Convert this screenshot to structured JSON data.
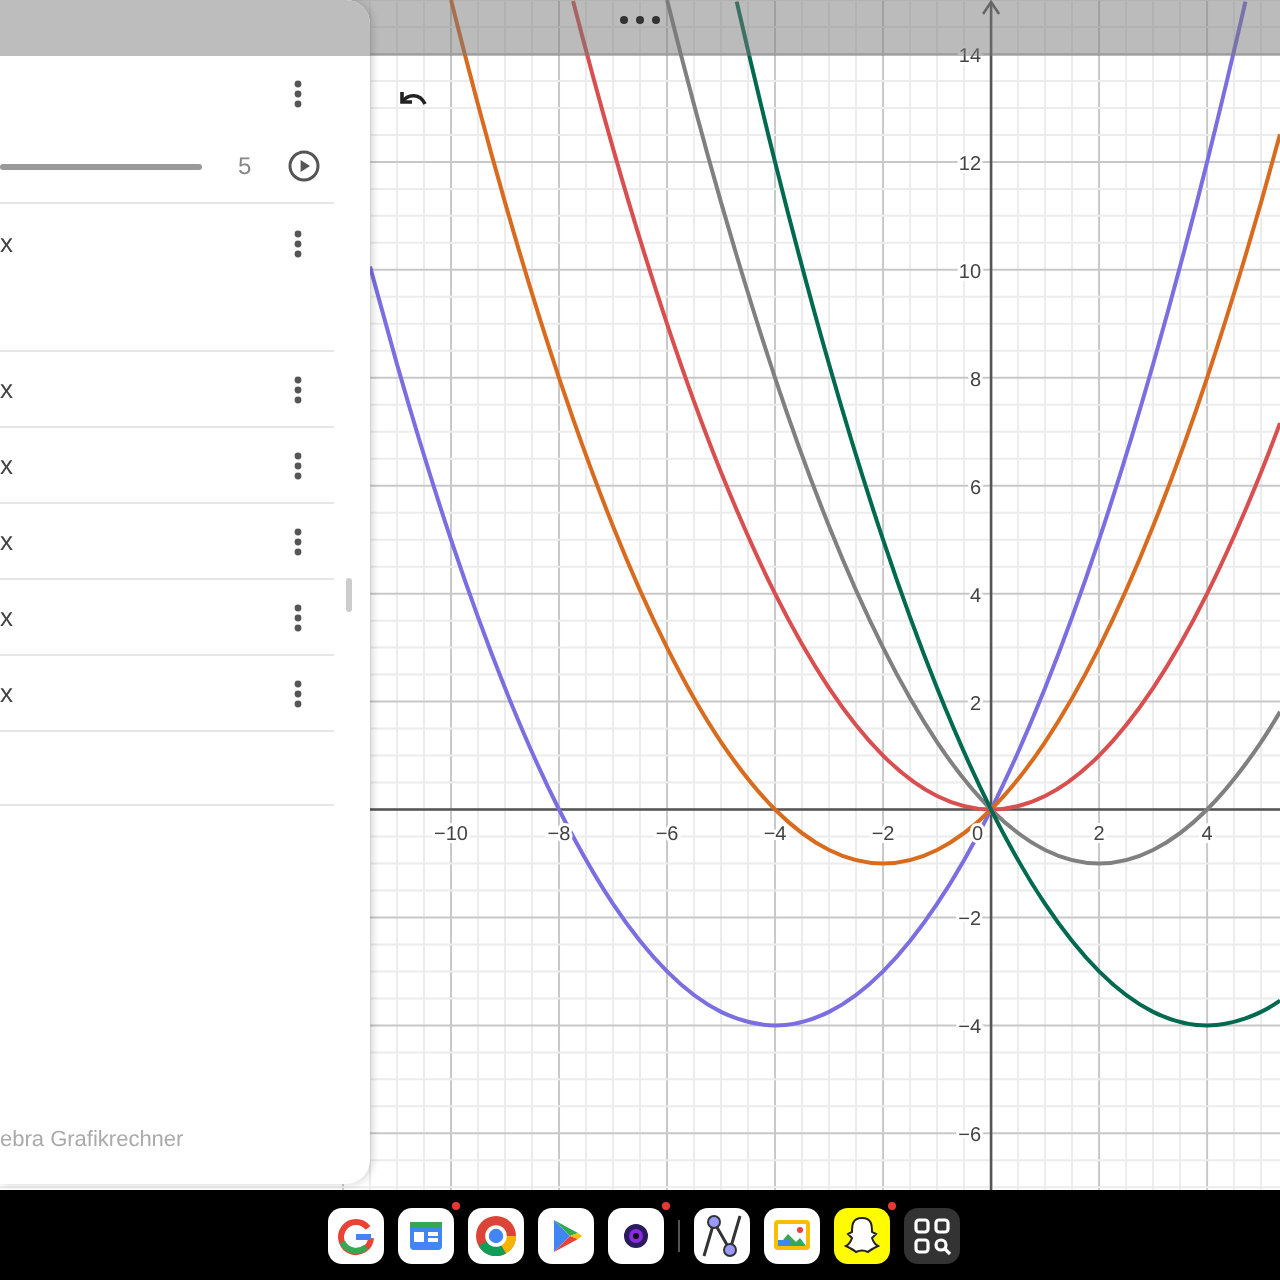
{
  "algebra_panel": {
    "items": [
      {
        "kind": "header"
      },
      {
        "kind": "slider",
        "value": "5"
      },
      {
        "kind": "expression",
        "text": "x",
        "tall": true
      },
      {
        "kind": "expression",
        "text": "x",
        "tall": false
      },
      {
        "kind": "expression",
        "text": "x",
        "tall": false
      },
      {
        "kind": "expression",
        "text": "x",
        "tall": false
      },
      {
        "kind": "expression",
        "text": "x",
        "tall": false
      },
      {
        "kind": "expression",
        "text": "x",
        "tall": false
      },
      {
        "kind": "empty"
      }
    ],
    "footer": "ebra Grafikrechner"
  },
  "graph": {
    "origin_label": "0",
    "chart_data": {
      "type": "line",
      "x": [
        -11.5,
        -11,
        -10,
        -9,
        -8,
        -7.74,
        -7,
        -6,
        -5,
        -4.71,
        -4,
        -3,
        -2,
        -1,
        0,
        1,
        2,
        3,
        4,
        4.71,
        5,
        5.35
      ],
      "series": [
        {
          "color": "#7b6ee0",
          "values": [
            10.06,
            8.25,
            5,
            2.25,
            0,
            -0.5,
            -1.75,
            -3,
            -3.75,
            -3.87,
            -4,
            -3.75,
            -3,
            -1.75,
            0,
            2.25,
            5,
            8.25,
            12,
            14.97,
            null,
            null
          ]
        },
        {
          "color": "#d96b1e",
          "values": [
            null,
            null,
            15,
            11.25,
            8,
            7.24,
            5.25,
            3,
            1.25,
            0.84,
            0,
            -0.75,
            -1,
            -0.75,
            0,
            1.25,
            3,
            5.25,
            8,
            10.26,
            11.25,
            12.51
          ]
        },
        {
          "color": "#d94f4f",
          "values": [
            null,
            null,
            null,
            null,
            null,
            14.98,
            12.25,
            9,
            6.25,
            5.55,
            4,
            2.25,
            1,
            0.25,
            0,
            0.25,
            1,
            2.25,
            4,
            5.55,
            6.25,
            7.16
          ]
        },
        {
          "color": "#808080",
          "values": [
            null,
            null,
            null,
            null,
            null,
            null,
            null,
            15,
            11.25,
            10.26,
            8,
            5.25,
            3,
            1.25,
            0,
            -0.75,
            -1,
            -0.75,
            0,
            0.84,
            1.25,
            1.81
          ]
        },
        {
          "color": "#006a50",
          "values": [
            null,
            null,
            null,
            null,
            null,
            null,
            null,
            null,
            null,
            14.97,
            12,
            8.25,
            5,
            2.25,
            0,
            -1.75,
            -3,
            -3.75,
            -4,
            -3.87,
            -3.75,
            -3.54
          ]
        }
      ],
      "grid": true,
      "xlim": [
        -11.5,
        5.35
      ],
      "ylim": [
        -7.05,
        15
      ],
      "xticks": [
        -10,
        -8,
        -6,
        -4,
        -2,
        2,
        4
      ],
      "yticks": [
        -6,
        -4,
        -2,
        2,
        4,
        6,
        8,
        10,
        12,
        14
      ]
    }
  },
  "dock": [
    {
      "kind": "google",
      "notification": false
    },
    {
      "kind": "news",
      "notification": true
    },
    {
      "kind": "chrome",
      "notification": false
    },
    {
      "kind": "play",
      "notification": false
    },
    {
      "kind": "camera",
      "notification": true
    },
    {
      "kind": "divider",
      "notification": false
    },
    {
      "kind": "graph",
      "notification": false
    },
    {
      "kind": "gallery",
      "notification": false
    },
    {
      "kind": "ghost",
      "notification": true
    },
    {
      "kind": "grid",
      "notification": false
    }
  ]
}
